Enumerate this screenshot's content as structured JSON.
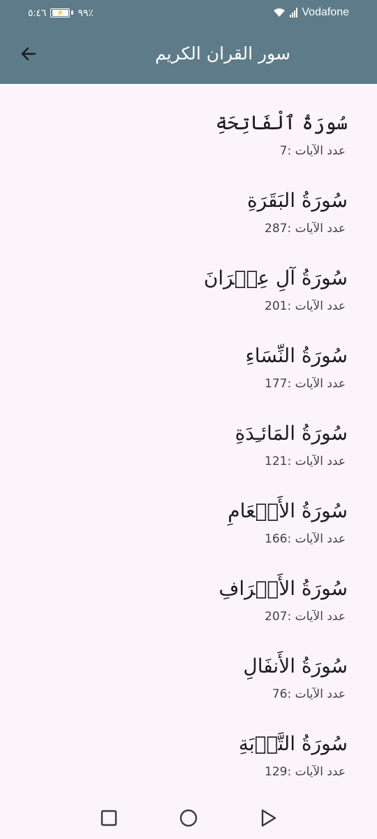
{
  "status_bar": {
    "time": "٥:٤٦",
    "battery_percent": "٩٩٪",
    "battery_level": 0.99,
    "carrier": "Vodafone"
  },
  "header": {
    "title": "سور القران الكريم",
    "back_icon": "arrow-back-icon"
  },
  "suras": [
    {
      "name": "سُورَةُ ٱلْفَاتِحَةِ",
      "verses": "عدد الآيات :7"
    },
    {
      "name": "سُورَةُ البَقَرَةِ",
      "verses": "عدد الآيات :287"
    },
    {
      "name": "سُورَةُ آلِ عِمۡرَانَ",
      "verses": "عدد الآيات :201"
    },
    {
      "name": "سُورَةُ النِّسَاءِ",
      "verses": "عدد الآيات :177"
    },
    {
      "name": "سُورَةُ المَائـِدَةِ",
      "verses": "عدد الآيات :121"
    },
    {
      "name": "سُورَةُ الأَنۡعَامِ",
      "verses": "عدد الآيات :166"
    },
    {
      "name": "سُورَةُ الأَعۡرَافِ",
      "verses": "عدد الآيات :207"
    },
    {
      "name": "سُورَةُ الأَنفَالِ",
      "verses": "عدد الآيات :76"
    },
    {
      "name": "سُورَةُ التَّوۡبَةِ",
      "verses": "عدد الآيات :129"
    }
  ],
  "nav_bar": {
    "recents_icon": "square-recents-icon",
    "home_icon": "circle-home-icon",
    "back_icon": "triangle-back-icon"
  },
  "colors": {
    "app_bar": "#5e7b8a",
    "background": "#fbf5fb",
    "title_text": "#1c1b1f",
    "subtitle_text": "#444047"
  }
}
